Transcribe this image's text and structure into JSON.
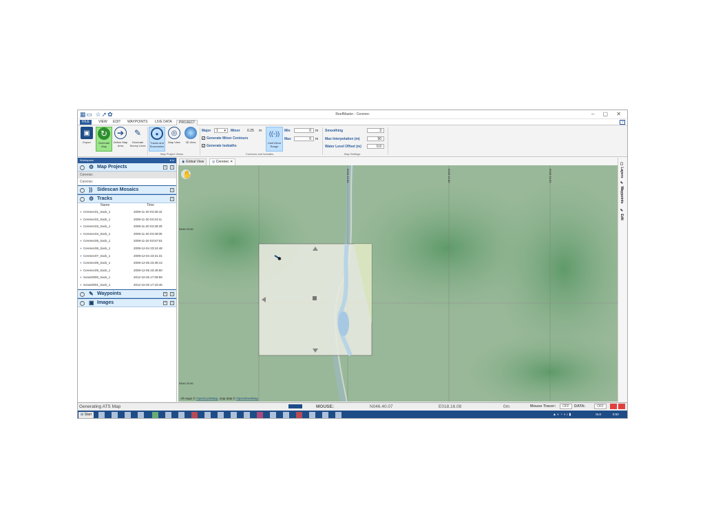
{
  "window": {
    "title": "ReefMaster - Cerenec",
    "controls": "–  ▢  ✕"
  },
  "quick_access": "▦▭ ☆➚✿",
  "menu": [
    "FILE",
    "VIEW",
    "EDIT",
    "WAYPOINTS",
    "LIVE DATA",
    "PROJECT"
  ],
  "help": "?",
  "ribbon": {
    "buttons": [
      {
        "label": "Export",
        "icon": "save-icon"
      },
      {
        "label": "Generate Map",
        "icon": "refresh-icon"
      },
      {
        "label": "Define Map Area",
        "icon": "arrow-right-icon"
      },
      {
        "label": "Generate Survey Lines",
        "icon": "pen-icon"
      },
      {
        "label": "Tracks and Boundaries",
        "icon": "target-icon"
      },
      {
        "label": "Map View",
        "icon": "contours-icon"
      },
      {
        "label": "3D View",
        "icon": "globe-icon"
      }
    ],
    "group_views": "Map Project Views",
    "contours": {
      "major_label": "Major",
      "major_value": "1",
      "minor_label": "Minor",
      "minor_value": "0.25",
      "minor_unit": "m",
      "gen_minor": "Generate Minor Contours",
      "gen_isobaths": "Generate Isobaths",
      "limit_minor": "Limit Minor Range",
      "min_label": "Min",
      "min_value": "0",
      "max_label": "Max",
      "max_value": "0",
      "unit": "m",
      "group": "Contours and Isobaths"
    },
    "settings": {
      "smoothing_label": "Smoothing",
      "smoothing_value": "3",
      "interp_label": "Max Interpolation (m)",
      "interp_value": "50",
      "offset_label": "Water Level Offset (m)",
      "offset_value": "0.0",
      "group": "Map Settings"
    }
  },
  "workspace": {
    "header": "Workspace",
    "map_projects": {
      "title": "Map Projects",
      "items": [
        "Cerenec",
        "Cerenec"
      ]
    },
    "sidescan": {
      "title": "Sidescan Mosaics"
    },
    "tracks": {
      "title": "Tracks",
      "col_name": "Name",
      "col_time": "Time",
      "rows": [
        {
          "name": "Cerenec01_track_1",
          "time": "2009-11-20 03:30:42"
        },
        {
          "name": "Cerenec02_track_1",
          "time": "2009-11-20 03:34:11"
        },
        {
          "name": "Cerenec03_track_1",
          "time": "2009-11-20 03:39:29"
        },
        {
          "name": "Cerenec04_track_1",
          "time": "2009-11-20 03:49:05"
        },
        {
          "name": "Cerenec05_track_1",
          "time": "2009-11-20 03:57:53"
        },
        {
          "name": "Cerenec06_track_1",
          "time": "2009-12-04 23:24:48"
        },
        {
          "name": "Cerenec07_track_1",
          "time": "2009-12-04 23:31:31"
        },
        {
          "name": "Cerenec08_track_1",
          "time": "2009-12-05 23:39:13"
        },
        {
          "name": "Cerenec09_track_1",
          "time": "2009-12-05 23:49:50"
        },
        {
          "name": "Sonar0000_track_1",
          "time": "2012-10-25 17:09:59"
        },
        {
          "name": "Sonar0001_track_1",
          "time": "2012-10-25 17:19:45"
        }
      ]
    },
    "waypoints": {
      "title": "Waypoints"
    },
    "images": {
      "title": "Images"
    }
  },
  "tabs": [
    {
      "label": "Global View"
    },
    {
      "label": "Cerenec",
      "close": "✕"
    }
  ],
  "map": {
    "lat_top": "N046 29.80",
    "lat_bottom": "N046 29.60",
    "lon_labels": [
      "E018 15.60",
      "E018 15.80",
      "E018 16.00",
      "E018 16.20"
    ],
    "attribution_prefix": "All maps ©",
    "attribution_link1": "OpenCycleMap",
    "attribution_mid": ", map data ©",
    "attribution_link2": "OpenStreetMap"
  },
  "right_panel": [
    "Layers",
    "Waypoints",
    "Edit"
  ],
  "status": {
    "message": "Generating ATS Map",
    "mouse_label": "MOUSE:",
    "lat": "N046.40.07",
    "lon": "E018.16.08",
    "depth": "0m",
    "tracer_label": "Mouse Tracer:",
    "tracer_value": "OFF",
    "data_label": "DATA:",
    "data_value": "OFF"
  },
  "taskbar": {
    "start": "Start",
    "lang": "SLK",
    "time": "8:50"
  }
}
